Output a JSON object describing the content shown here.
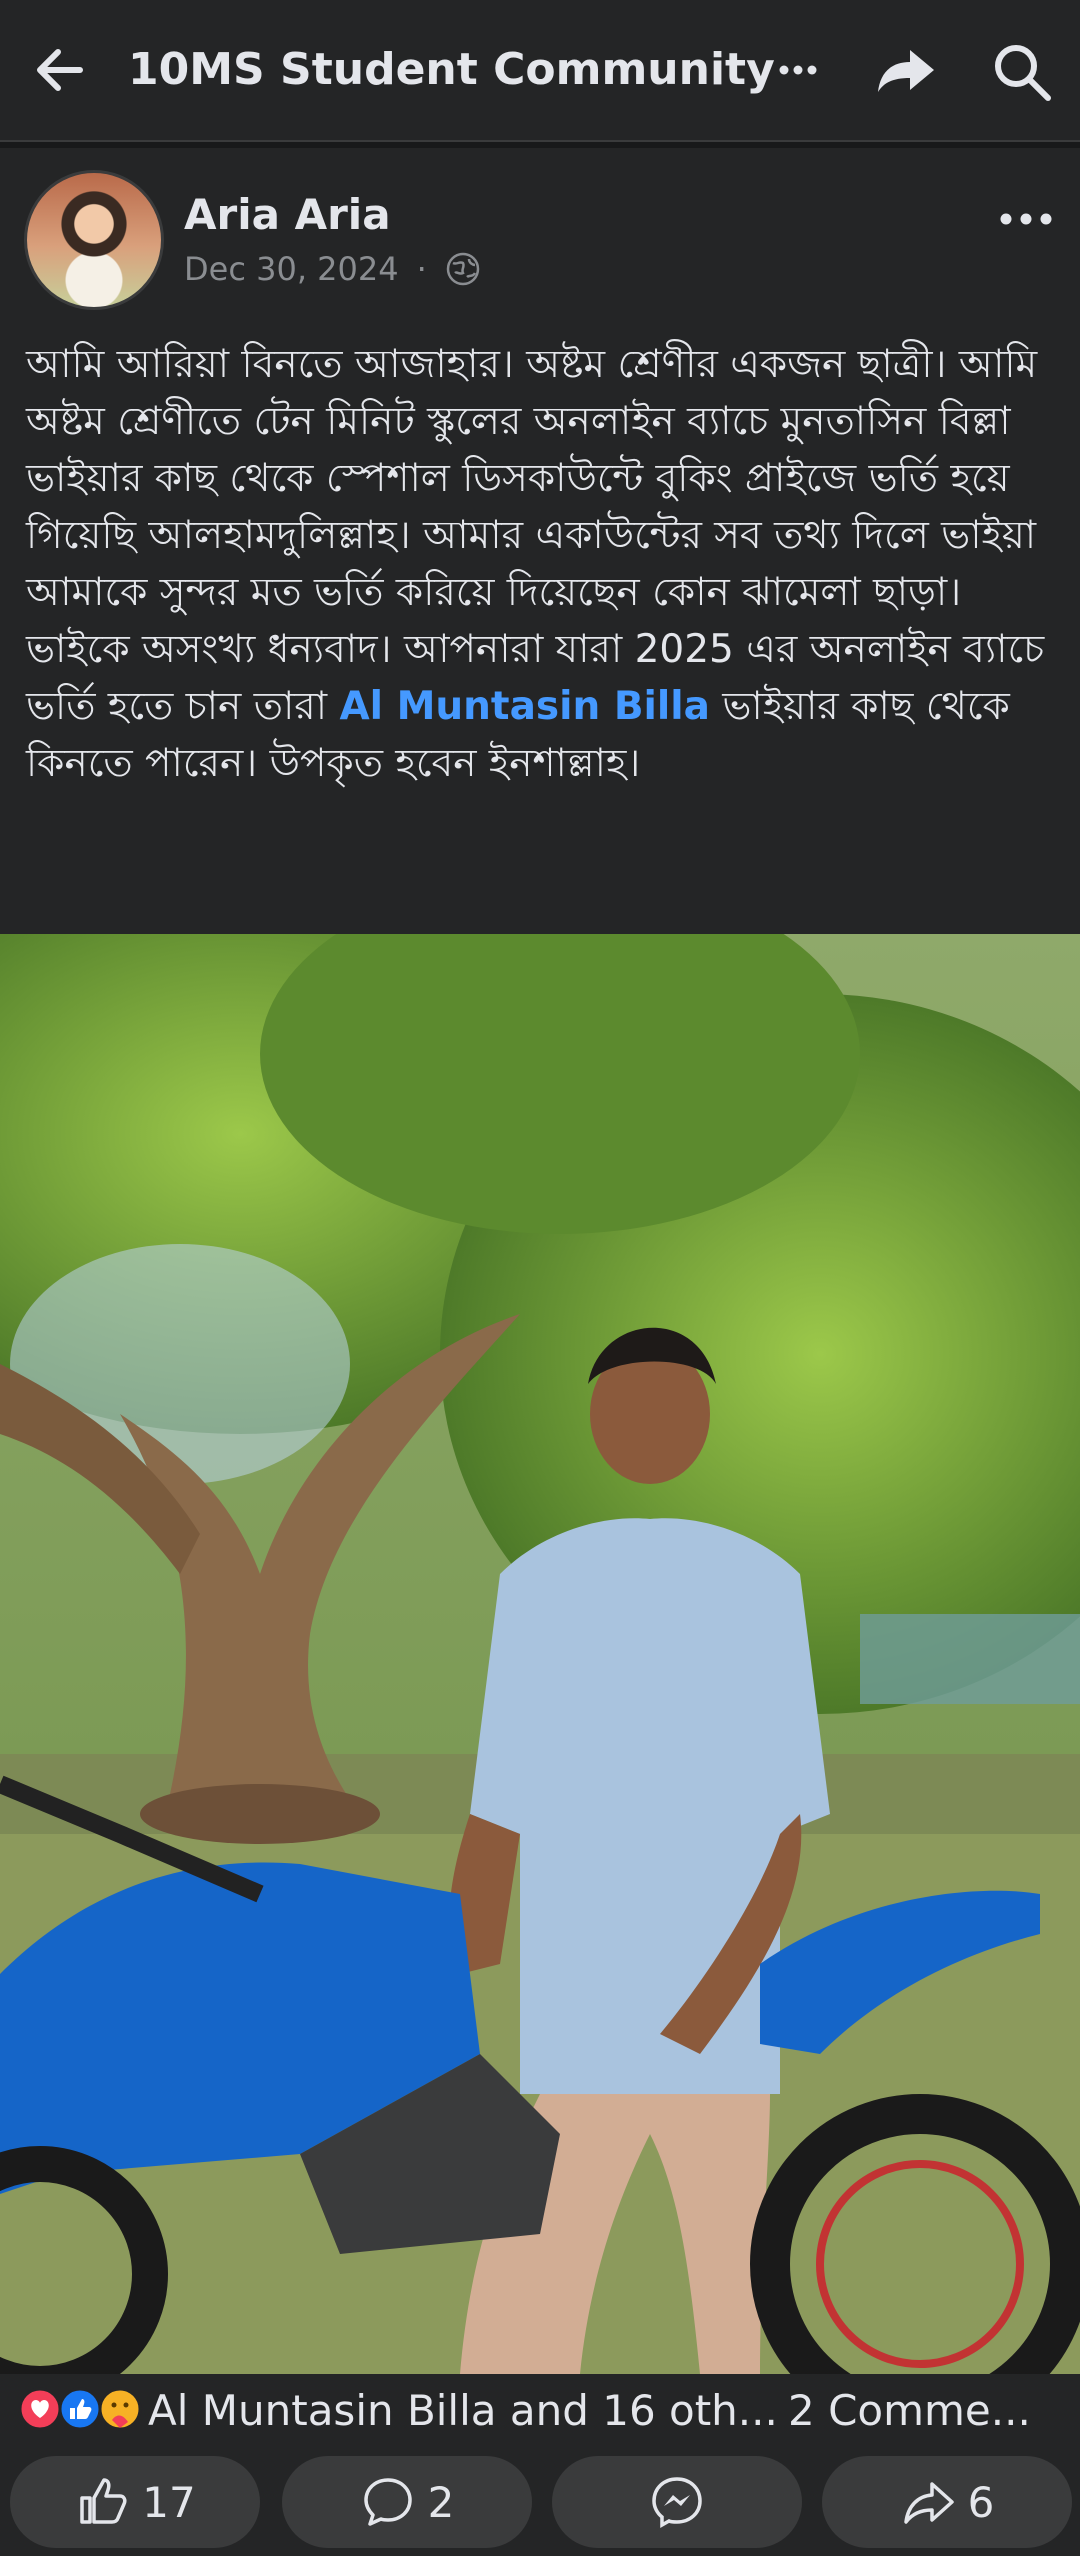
{
  "header": {
    "title": "10MS Student Community",
    "icons": [
      "back-arrow-icon",
      "more-icon",
      "share-icon",
      "search-icon"
    ]
  },
  "post": {
    "author": "Aria Aria",
    "date": "Dec 30, 2024",
    "separator": "·",
    "text_before_link": "আমি আরিয়া বিনতে আজাহার। অষ্টম শ্রেণীর একজন ছাত্রী। আমি অষ্টম শ্রেণীতে টেন মিনিট স্কুলের অনলাইন ব্যাচে মুনতাসিন বিল্লা ভাইয়ার কাছ থেকে স্পেশাল ডিসকাউন্টে বুকিং প্রাইজে ভর্তি হয়ে গিয়েছি আলহামদুলিল্লাহ। আমার একাউন্টের সব তথ্য দিলে ভাইয়া আমাকে সুন্দর মত ভর্তি করিয়ে দিয়েছেন কোন ঝামেলা ছাড়া। ভাইকে অসংখ্য ধন্যবাদ। আপনারা যারা 2025 এর অনলাইন ব্যাচে ভর্তি হতে চান তারা ",
    "link_text": "Al Muntasin Billa",
    "text_after_link": " ভাইয়ার কাছ থেকে কিনতে পারেন। উপকৃত হবেন ইনশাল্লাহ।"
  },
  "reactions": {
    "summary": "Al Muntasin Billa and 16 oth...",
    "comments": "2 Comme...",
    "icons": [
      "love-reaction-icon",
      "like-reaction-icon",
      "care-reaction-icon"
    ]
  },
  "actions": {
    "like_count": "17",
    "comment_count": "2",
    "share_count": "6"
  },
  "colors": {
    "background": "#242526",
    "text": "#e4e6eb",
    "muted": "#8a8d91",
    "link": "#4599ff",
    "button": "#3a3b3c"
  }
}
